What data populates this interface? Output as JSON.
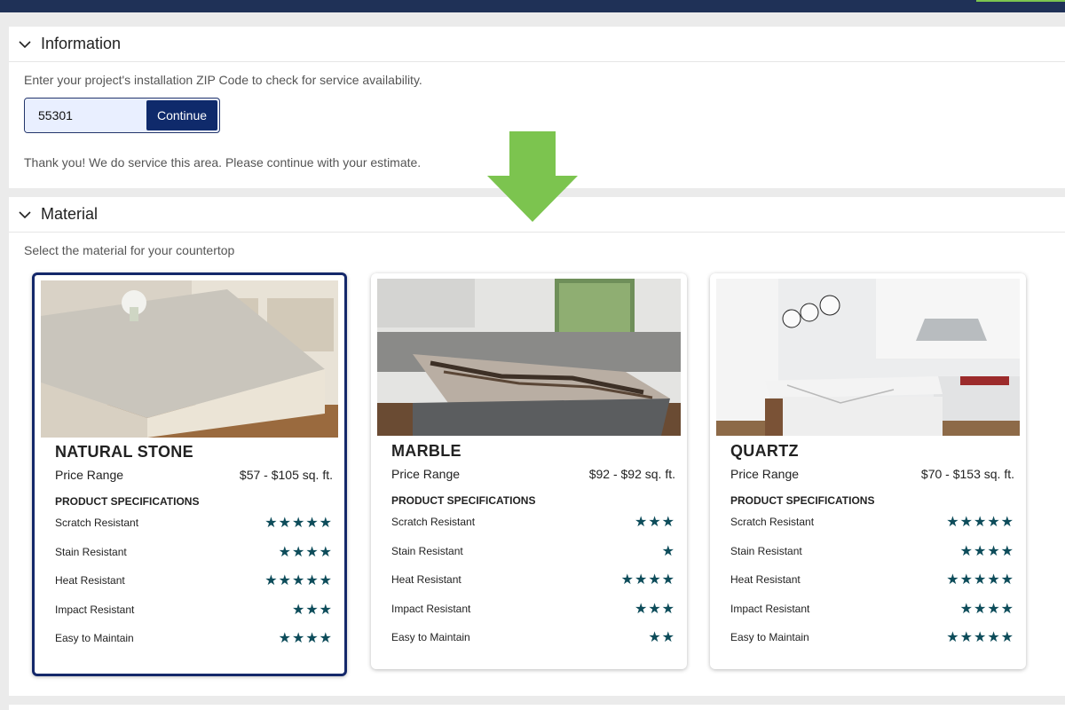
{
  "info": {
    "title": "Information",
    "prompt": "Enter your project's installation ZIP Code to check for service availability.",
    "zip_value": "55301",
    "continue_label": "Continue",
    "confirmation": "Thank you! We do service this area. Please continue with your estimate."
  },
  "material": {
    "title": "Material",
    "prompt": "Select the material for your countertop",
    "price_label": "Price Range",
    "specs_heading": "PRODUCT SPECIFICATIONS",
    "cards": [
      {
        "name": "NATURAL STONE",
        "price": "$57 - $105 sq. ft.",
        "selected": true,
        "specs": [
          {
            "label": "Scratch Resistant",
            "rating": 5
          },
          {
            "label": "Stain Resistant",
            "rating": 4
          },
          {
            "label": "Heat Resistant",
            "rating": 5
          },
          {
            "label": "Impact Resistant",
            "rating": 3
          },
          {
            "label": "Easy to Maintain",
            "rating": 4
          }
        ]
      },
      {
        "name": "MARBLE",
        "price": "$92 - $92 sq. ft.",
        "selected": false,
        "specs": [
          {
            "label": "Scratch Resistant",
            "rating": 3
          },
          {
            "label": "Stain Resistant",
            "rating": 1
          },
          {
            "label": "Heat Resistant",
            "rating": 4
          },
          {
            "label": "Impact Resistant",
            "rating": 3
          },
          {
            "label": "Easy to Maintain",
            "rating": 2
          }
        ]
      },
      {
        "name": "QUARTZ",
        "price": "$70 - $153 sq. ft.",
        "selected": false,
        "specs": [
          {
            "label": "Scratch Resistant",
            "rating": 5
          },
          {
            "label": "Stain Resistant",
            "rating": 4
          },
          {
            "label": "Heat Resistant",
            "rating": 5
          },
          {
            "label": "Impact Resistant",
            "rating": 4
          },
          {
            "label": "Easy to Maintain",
            "rating": 5
          }
        ]
      }
    ]
  },
  "colors": {
    "navy": "#1f3157",
    "button": "#0f2a6b",
    "arrow": "#7cc44f",
    "star": "#0d4c5a"
  }
}
